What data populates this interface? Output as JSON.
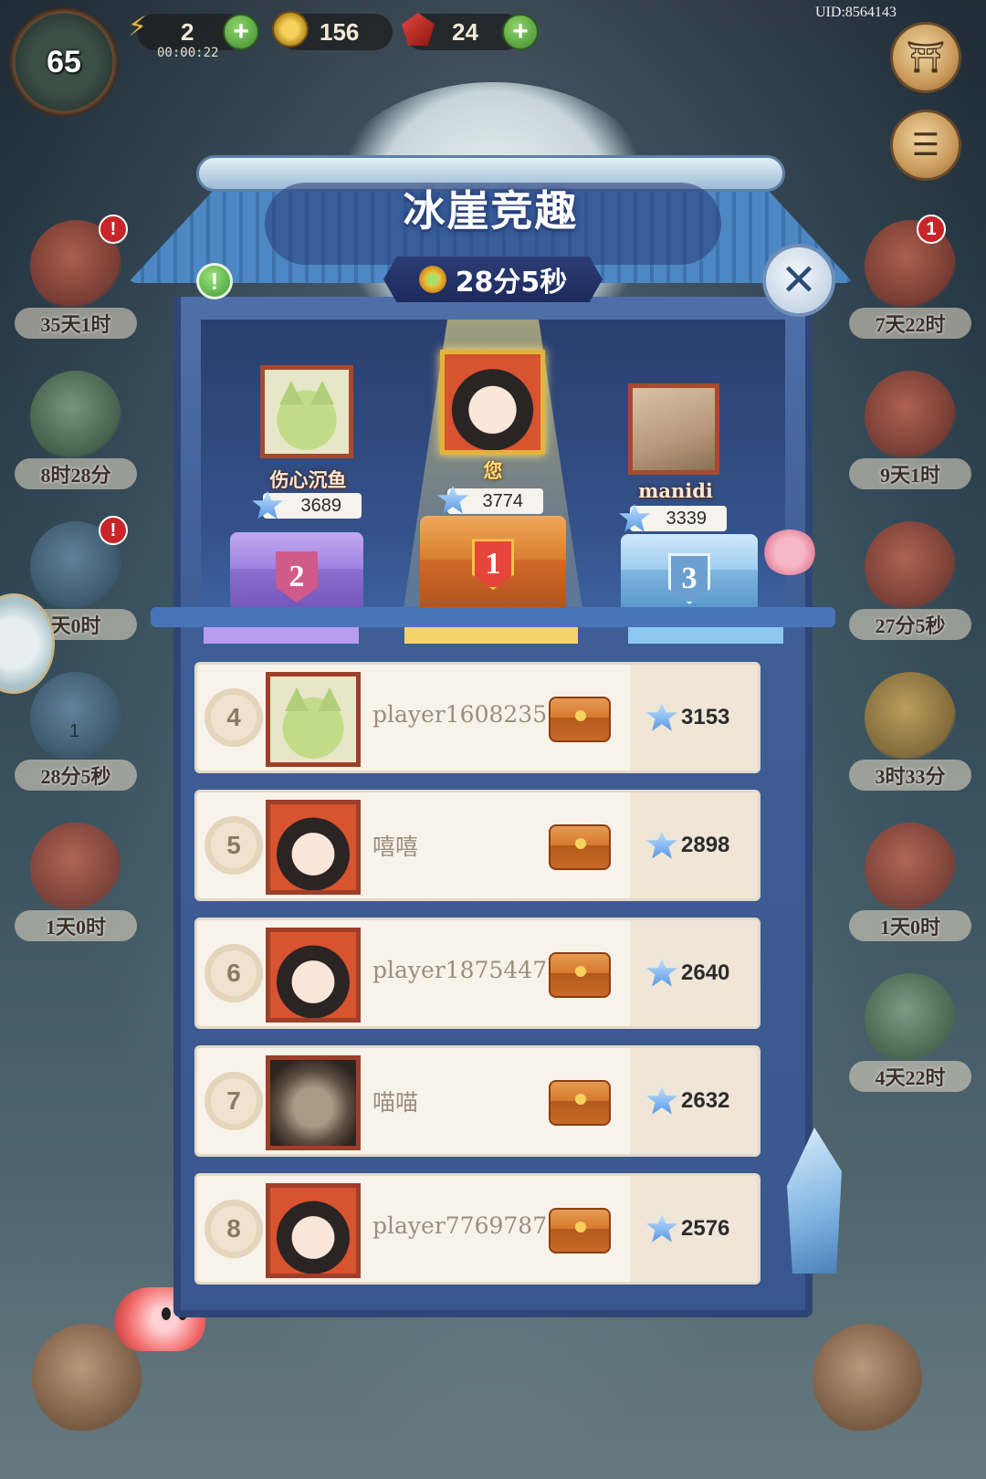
{
  "hud": {
    "level": "65",
    "energy": "2",
    "energy_timer": "00:00:22",
    "coins": "156",
    "gems": "24",
    "uid": "UID:8564143"
  },
  "left_events": [
    {
      "label": "35天1时",
      "badge": "!"
    },
    {
      "label": "8时28分",
      "badge": ""
    },
    {
      "label": "天0时",
      "badge": "!"
    },
    {
      "label": "28分5秒",
      "count": "1"
    },
    {
      "label": "1天0时",
      "badge": ""
    }
  ],
  "right_events": [
    {
      "label": "7天22时",
      "badge": "1"
    },
    {
      "label": "9天1时"
    },
    {
      "label": "27分5秒"
    },
    {
      "label": "3时33分"
    },
    {
      "label": "1天0时"
    },
    {
      "label": "4天22时"
    }
  ],
  "panel": {
    "title": "冰崖竞趣",
    "timer": "28分5秒",
    "info_icon": "!",
    "close_icon": "✕"
  },
  "podium": [
    {
      "rank": "2",
      "name": "伤心沉鱼",
      "score": "3689",
      "avatar": "cat"
    },
    {
      "rank": "1",
      "name": "您",
      "score": "3774",
      "avatar": "girl"
    },
    {
      "rank": "3",
      "name": "manidi",
      "score": "3339",
      "avatar": "photo"
    }
  ],
  "leaderboard": [
    {
      "rank": "4",
      "name": "player16082357",
      "score": "3153",
      "avatar": "cat"
    },
    {
      "rank": "5",
      "name": "嘻嘻",
      "score": "2898",
      "avatar": "girl"
    },
    {
      "rank": "6",
      "name": "player18754478",
      "score": "2640",
      "avatar": "girl"
    },
    {
      "rank": "7",
      "name": "喵喵",
      "score": "2632",
      "avatar": "kitten"
    },
    {
      "rank": "8",
      "name": "player7769787",
      "score": "2576",
      "avatar": "girl"
    }
  ],
  "colors": {
    "accent_blue": "#3f5e96",
    "gold": "#e2b33a",
    "purple_chest": "#8b6fd0",
    "blue_chest": "#7fb7e0",
    "orange_chest": "#d67a2e"
  }
}
